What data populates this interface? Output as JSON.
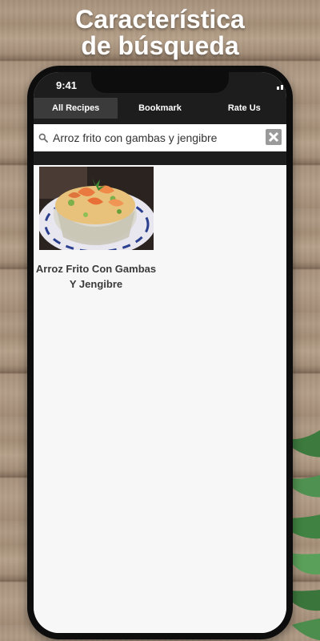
{
  "header": {
    "line1": "Característica",
    "line2": "de búsqueda"
  },
  "status_bar": {
    "time": "9:41"
  },
  "tabs": [
    {
      "label": "All Recipes",
      "active": true
    },
    {
      "label": "Bookmark",
      "active": false
    },
    {
      "label": "Rate Us",
      "active": false
    }
  ],
  "search": {
    "value": "Arroz frito con gambas y jengibre"
  },
  "results": [
    {
      "title": "Arroz Frito Con Gambas Y Jengibre",
      "image": "fried-rice-shrimp-photo"
    }
  ],
  "colors": {
    "app_bar": "#1d1d1d",
    "active_tab": "#3b3b3b",
    "screen_bg": "#f7f7f7"
  }
}
